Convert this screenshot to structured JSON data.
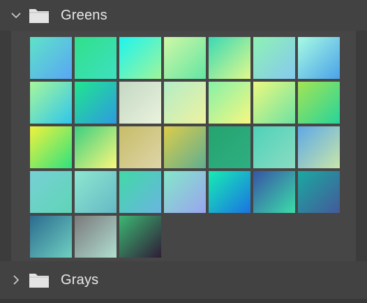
{
  "groups": [
    {
      "name": "Greens",
      "expanded": true,
      "chevron_icon": "chevron-down-icon",
      "folder_icon": "folder-icon"
    },
    {
      "name": "Grays",
      "expanded": false,
      "chevron_icon": "chevron-right-icon",
      "folder_icon": "folder-icon"
    }
  ],
  "swatch_colors": [
    [
      "#5fe3c7",
      "#58a6f5"
    ],
    [
      "#2fe08a",
      "#3ee0c0"
    ],
    [
      "#1ef4ee",
      "#9ff59a"
    ],
    [
      "#d0f7a6",
      "#62e6a3"
    ],
    [
      "#3ad9b3",
      "#e1f98d"
    ],
    [
      "#8ef2b2",
      "#86c9f0"
    ],
    [
      "#a7fbe3",
      "#4aa2e8"
    ],
    [
      "#a7f79a",
      "#2fc6ec"
    ],
    [
      "#21e58d",
      "#2d9be0"
    ],
    [
      "#c4d8c4",
      "#eaf2dc"
    ],
    [
      "#b4ecc7",
      "#eef2a0"
    ],
    [
      "#86f1a8",
      "#f7f781"
    ],
    [
      "#ecf97f",
      "#6ee2a2"
    ],
    [
      "#a3e554",
      "#27d49b"
    ],
    [
      "#f0f23d",
      "#2ee27f"
    ],
    [
      "#3ccf80",
      "#fbf77c"
    ],
    [
      "#c7bd68",
      "#ded4a9"
    ],
    [
      "#dccd4a",
      "#5fae90"
    ],
    [
      "#25a46f",
      "#2fae83"
    ],
    [
      "#4fd2b9",
      "#8adcc2"
    ],
    [
      "#5ea9e6",
      "#c9e6a9"
    ],
    [
      "#77d0d5",
      "#5fd5b6"
    ],
    [
      "#8ce7cf",
      "#66b9c6"
    ],
    [
      "#41d9a6",
      "#6ab5e0"
    ],
    [
      "#83e7c8",
      "#9aa4ef"
    ],
    [
      "#18ecb2",
      "#1a73e3"
    ],
    [
      "#3854a6",
      "#3bdda9"
    ],
    [
      "#1aa9a1",
      "#445a9a"
    ],
    [
      "#2b6b8f",
      "#6fd0c1"
    ],
    [
      "#7a7a7a",
      "#b0ded1"
    ],
    [
      "#3bb873",
      "#2f1c37"
    ]
  ]
}
